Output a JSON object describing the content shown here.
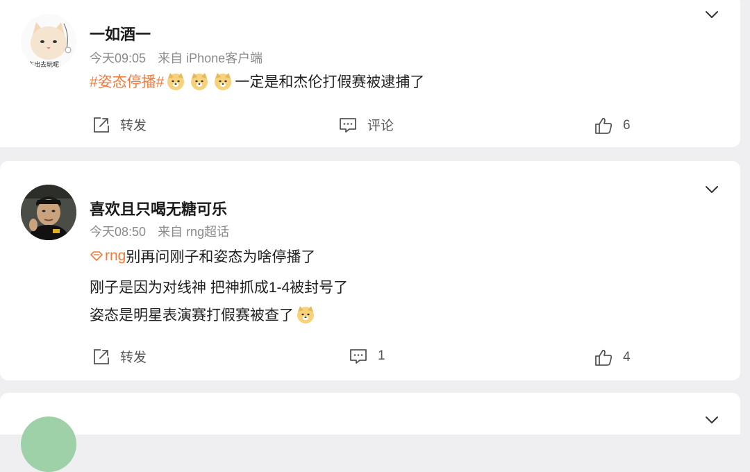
{
  "posts": [
    {
      "username": "一如酒一",
      "time": "今天09:05",
      "source": "来自 iPhone客户端",
      "hashtag": "#姿态停播#",
      "text": "一定是和杰伦打假赛被逮捕了",
      "actions": {
        "repost_label": "转发",
        "comment_label": "评论",
        "like_count": "6"
      }
    },
    {
      "username": "喜欢且只喝无糖可乐",
      "time": "今天08:50",
      "source": "来自 rng超话",
      "topic": "rng",
      "lines": [
        "别再问刚子和姿态为啥停播了",
        "刚子是因为对线神 把神抓成1-4被封号了",
        "姿态是明星表演赛打假赛被查了"
      ],
      "actions": {
        "repost_label": "转发",
        "comment_count": "1",
        "like_count": "4"
      }
    }
  ],
  "colors": {
    "hashtag": "#f07a3a",
    "meta_text": "#8a8a8a",
    "background": "#efeff1",
    "card": "#ffffff"
  },
  "icons": [
    "chevron-down-icon",
    "repost-icon",
    "comment-icon",
    "like-icon",
    "doge-emoji-icon",
    "super-topic-icon"
  ]
}
